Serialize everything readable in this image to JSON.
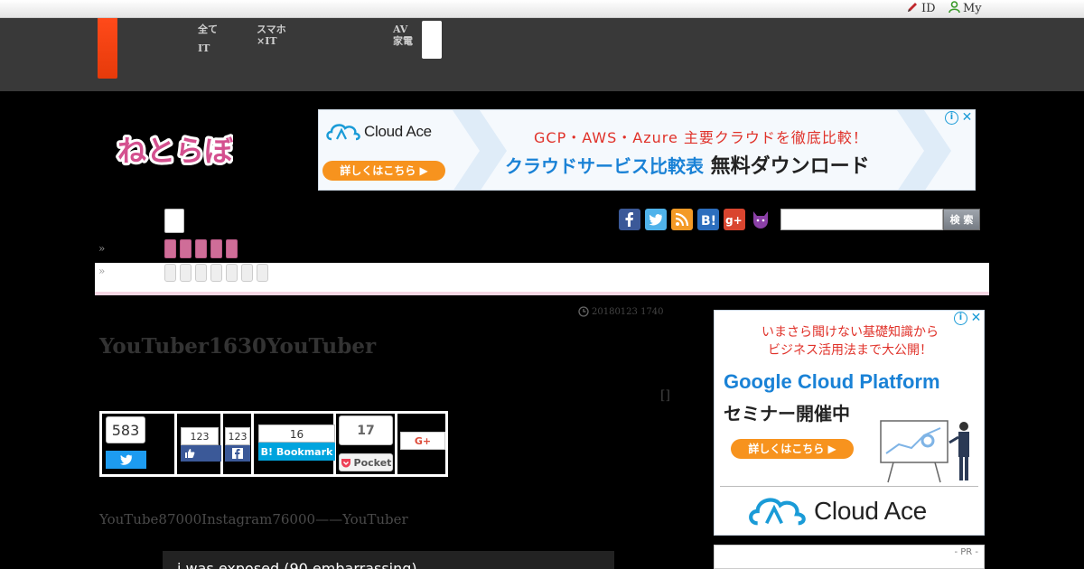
{
  "topbar": {
    "id_label": "ID",
    "my_label": "My"
  },
  "gnav": {
    "item1": [
      "全て",
      "IT"
    ],
    "item2": [
      "スマホ",
      "×IT"
    ],
    "item3": [
      "AV",
      "家電"
    ]
  },
  "logo": {
    "text": "ねとらぼ"
  },
  "ad_top": {
    "brand": "Cloud Ace",
    "button": "詳しくはこちら ▶",
    "headline1": "GCP・AWS・Azure 主要クラウドを徹底比較！",
    "headline2_blue": "クラウドサービス比較表",
    "headline2": "無料ダウンロード"
  },
  "ad_side": {
    "line1": "いまさら聞けない基礎知識から",
    "line2": "ビジネス活用法まで大公開！",
    "product": "Google Cloud Platform",
    "subhead": "セミナー開催中",
    "button": "詳しくはこちら ▶",
    "brand": "Cloud Ace"
  },
  "search": {
    "button": "検 索",
    "placeholder": ""
  },
  "breadcrumb_marker": "»",
  "article": {
    "date": "20180123 1740",
    "title": "YouTuber1630YouTuber",
    "mini": "[]",
    "lead": "YouTube87000Instagram76000——YouTuber",
    "video_title": "i was exposed (90 embarrassing)..."
  },
  "share": {
    "twitter_count": "583",
    "like_count": "123",
    "fb_share_count": "123",
    "hatena_count": "16",
    "hatena_label": "B! Bookmark",
    "pocket_count": "17",
    "pocket_label": "Pocket",
    "gplus_label": "G+"
  },
  "pr_label": "- PR -",
  "colors": {
    "nav_bg": "#393939",
    "home_tab": "#ff4a1a",
    "pink_accent": "#cf6d98",
    "twitter": "#1d9bf0",
    "facebook": "#3b5998",
    "hatena": "#00a4de",
    "pocket": "#ee4056"
  }
}
